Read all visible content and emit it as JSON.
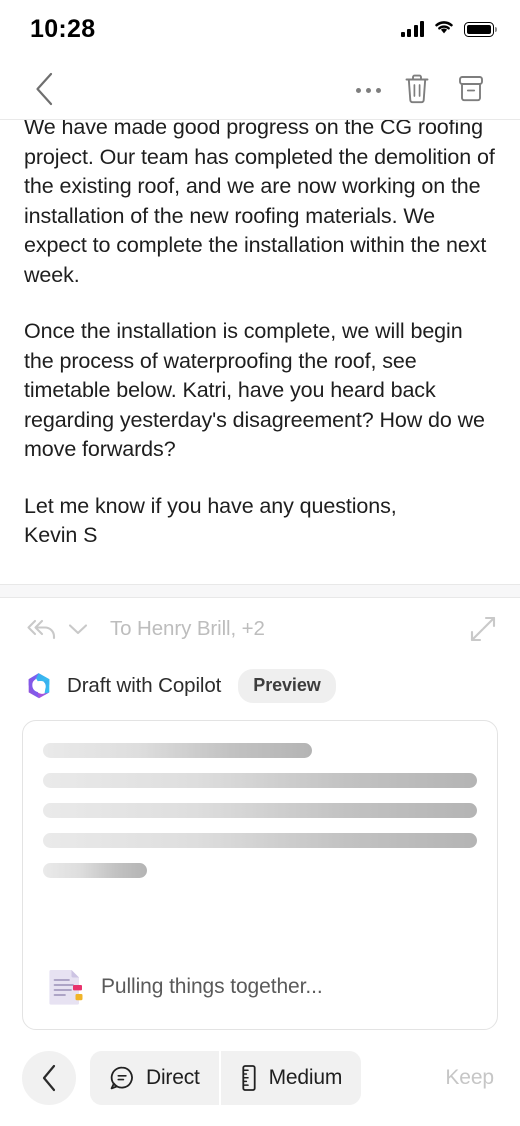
{
  "status_bar": {
    "time": "10:28",
    "signal_icon": "cellular-signal-icon",
    "wifi_icon": "wifi-icon",
    "battery_icon": "battery-full-icon"
  },
  "nav_bar": {
    "back_icon": "chevron-left-icon",
    "more_icon": "more-horizontal-icon",
    "delete_icon": "trash-icon",
    "archive_icon": "archive-icon"
  },
  "mail": {
    "paragraphs": [
      "We have made good progress on the CG roofing project. Our team has completed the demolition of the existing roof, and we are now working on the installation of the new roofing materials. We expect to complete the installation within the next week.",
      "Once the installation is complete, we will begin the process of waterproofing the roof, see timetable below. Katri, have you heard back regarding yesterday's disagreement? How do we move forwards?",
      "Let me know if you have any questions,"
    ],
    "signature": "Kevin S",
    "expand_quoted_icon": "ellipsis-expand-icon"
  },
  "reply": {
    "reply_all_icon": "reply-all-icon",
    "recipients_chevron_icon": "chevron-down-icon",
    "recipients": "To Henry Brill, +2",
    "expand_icon": "expand-diagonal-icon"
  },
  "copilot": {
    "logo_icon": "copilot-logo-icon",
    "label": "Draft with Copilot",
    "badge": "Preview",
    "colors": {
      "purple": "#8b5cf6",
      "violet": "#a855c8",
      "blue": "#3a8fdd",
      "cyan": "#36bdf0"
    }
  },
  "draft_card": {
    "skeleton_bars": [
      {
        "width": "62%"
      },
      {
        "width": "100%"
      },
      {
        "width": "100%"
      },
      {
        "width": "100%"
      },
      {
        "width": "24%"
      }
    ],
    "status_icon": "document-processing-icon",
    "status_text": "Pulling things together..."
  },
  "toolbar": {
    "back_icon": "chevron-left-icon",
    "tone_icon": "speech-bubble-icon",
    "tone_label": "Direct",
    "length_icon": "ruler-icon",
    "length_label": "Medium",
    "keep_label": "Keep"
  }
}
